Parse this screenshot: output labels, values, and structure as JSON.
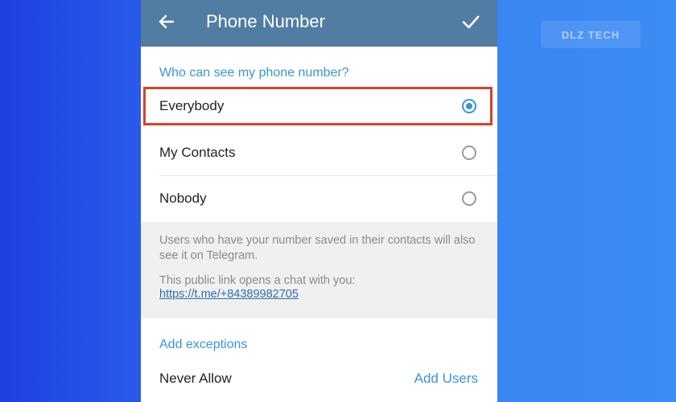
{
  "watermark": {
    "text": "DLZ TECH"
  },
  "appbar": {
    "title": "Phone Number",
    "back_icon": "arrow-left-icon",
    "confirm_icon": "checkmark-icon",
    "color": "#527da3"
  },
  "visibility": {
    "header": "Who can see my phone number?",
    "options": [
      {
        "label": "Everybody",
        "selected": true
      },
      {
        "label": "My Contacts",
        "selected": false
      },
      {
        "label": "Nobody",
        "selected": false
      }
    ]
  },
  "info": {
    "line1": "Users who have your number saved in their contacts will also see it on Telegram.",
    "line2": "This public link opens a chat with you:",
    "link": "https://t.me/+84389982705"
  },
  "exceptions": {
    "header": "Add exceptions",
    "never_allow_label": "Never Allow",
    "add_users_label": "Add Users"
  },
  "colors": {
    "accent": "#3a95d5",
    "highlight": "#d9402b",
    "link": "#2a6fb0"
  }
}
